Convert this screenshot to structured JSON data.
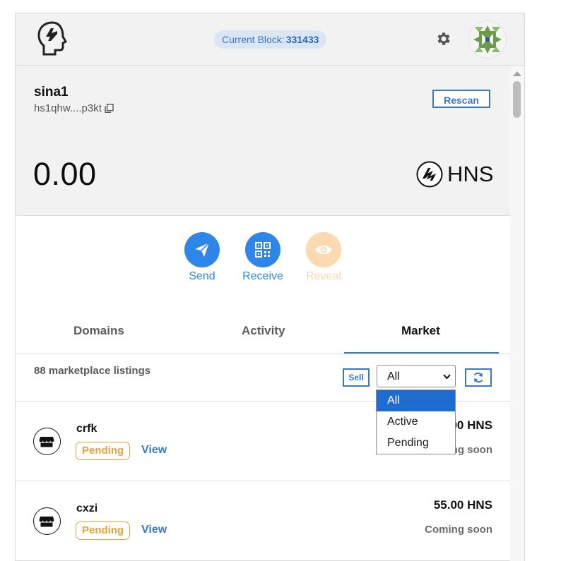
{
  "header": {
    "block_label": "Current Block:",
    "block_number": "331433",
    "settings_icon": "gear-icon",
    "avatar_icon": "identicon-avatar"
  },
  "wallet": {
    "name": "sina1",
    "address": "hs1qhw....p3kt",
    "rescan_label": "Rescan",
    "balance": "0.00",
    "currency": "HNS"
  },
  "actions": [
    {
      "label": "Send",
      "icon": "send-icon",
      "color": "#2e86e8"
    },
    {
      "label": "Receive",
      "icon": "qr-code-icon",
      "color": "#2e86e8"
    },
    {
      "label": "Reveal",
      "icon": "eye-icon",
      "color": "#fcd9b0"
    }
  ],
  "tabs": [
    {
      "label": "Domains",
      "active": false
    },
    {
      "label": "Activity",
      "active": false
    },
    {
      "label": "Market",
      "active": true
    }
  ],
  "market": {
    "listings_count": "88 marketplace listings",
    "sell_label": "Sell",
    "filter_value": "All",
    "filter_options": [
      "All",
      "Active",
      "Pending"
    ],
    "listings": [
      {
        "name": "crfk",
        "status": "Pending",
        "view_label": "View",
        "price": "55.00 HNS",
        "note": "Coming soon"
      },
      {
        "name": "cxzi",
        "status": "Pending",
        "view_label": "View",
        "price": "55.00 HNS",
        "note": "Coming soon"
      }
    ]
  },
  "colors": {
    "accent": "#3a78c9",
    "pending": "#e7a23a",
    "header_bg": "#f2f2f2"
  }
}
